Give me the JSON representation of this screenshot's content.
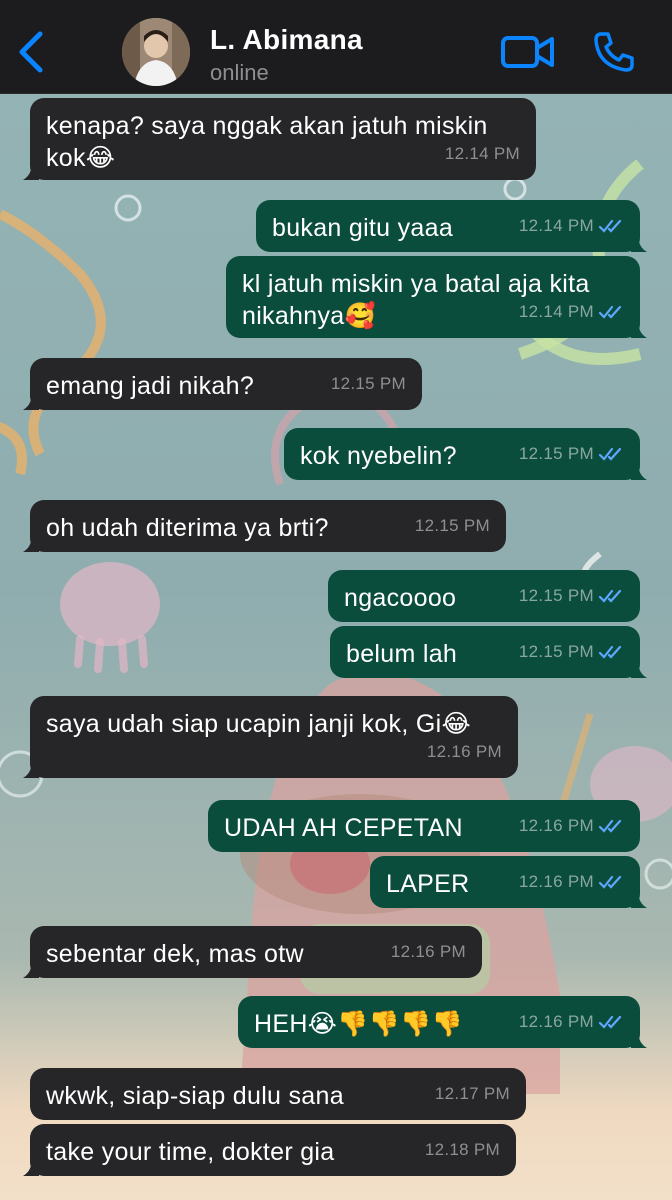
{
  "header": {
    "contact_name": "L. Abimana",
    "status": "online"
  },
  "colors": {
    "header_bg": "#1c1c1e",
    "accent_blue": "#0a84ff",
    "incoming_bubble": "#262628",
    "outgoing_bubble": "#0b4d3d",
    "read_ticks": "#5fa8ff"
  },
  "icons": {
    "back": "chevron-left-icon",
    "video": "video-camera-icon",
    "call": "phone-icon",
    "read": "double-check-icon"
  },
  "messages": [
    {
      "dir": "in",
      "text": "kenapa? saya nggak akan jatuh miskin",
      "text2": "kok😂",
      "time": "12.14 PM"
    },
    {
      "dir": "out",
      "text": "bukan gitu yaaa",
      "time": "12.14 PM"
    },
    {
      "dir": "out",
      "text": "kl jatuh miskin ya batal aja kita",
      "text2": "nikahnya🥰",
      "time": "12.14 PM"
    },
    {
      "dir": "in",
      "text": "emang jadi nikah?",
      "time": "12.15 PM"
    },
    {
      "dir": "out",
      "text": "kok nyebelin?",
      "time": "12.15 PM"
    },
    {
      "dir": "in",
      "text": "oh udah diterima ya brti?",
      "time": "12.15 PM"
    },
    {
      "dir": "out",
      "text": "ngacoooo",
      "time": "12.15 PM"
    },
    {
      "dir": "out",
      "text": "belum lah",
      "time": "12.15 PM"
    },
    {
      "dir": "in",
      "text": "saya udah siap ucapin janji kok, Gi😂",
      "time": "12.16 PM"
    },
    {
      "dir": "out",
      "text": "UDAH AH CEPETAN",
      "time": "12.16 PM"
    },
    {
      "dir": "out",
      "text": "LAPER",
      "time": "12.16 PM"
    },
    {
      "dir": "in",
      "text": "sebentar dek, mas otw",
      "time": "12.16 PM"
    },
    {
      "dir": "out",
      "text": "HEH😭👎👎👎👎",
      "time": "12.16 PM"
    },
    {
      "dir": "in",
      "text": "wkwk, siap-siap dulu sana",
      "time": "12.17 PM"
    },
    {
      "dir": "in",
      "text": "take your time, dokter gia",
      "time": "12.18 PM"
    }
  ]
}
